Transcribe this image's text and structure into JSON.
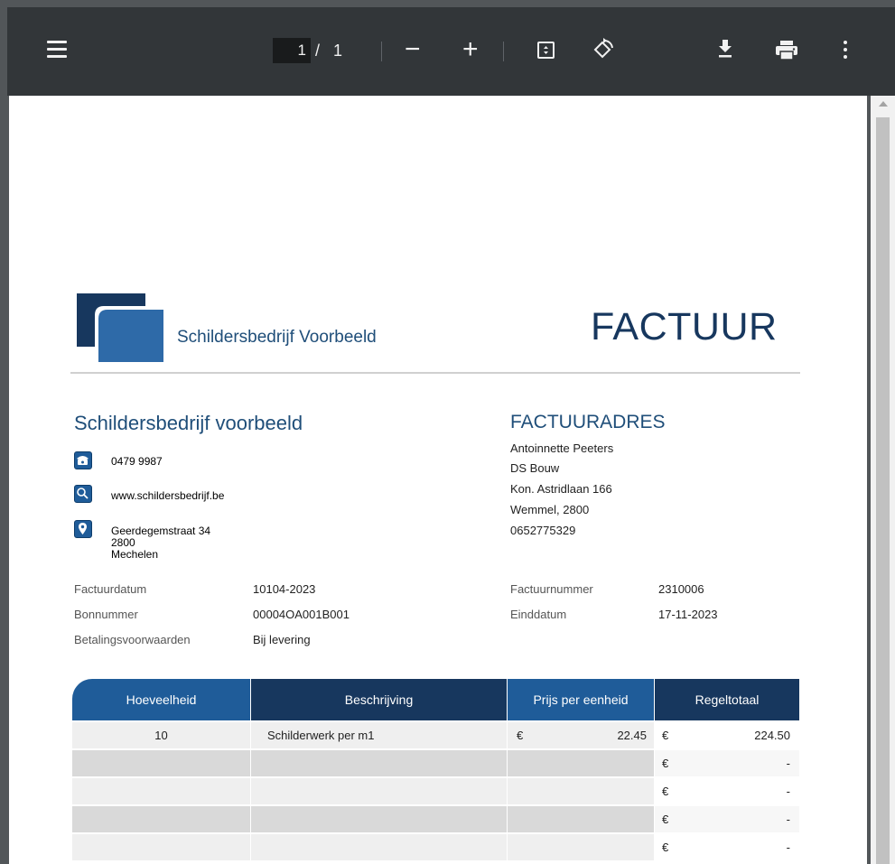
{
  "toolbar": {
    "current_page": "1",
    "page_separator": "/",
    "total_pages": "1",
    "zoom_out": "−",
    "zoom_in": "+",
    "icons": [
      "menu-icon",
      "fit-page-icon",
      "rotate-icon",
      "download-icon",
      "print-icon",
      "more-icon"
    ],
    "bg_color": "#323639"
  },
  "invoice": {
    "header_company": "Schildersbedrijf Voorbeeld",
    "title": "FACTUUR",
    "sender": {
      "name": "Schildersbedrijf voorbeeld",
      "phone": "0479 9987",
      "website": "www.schildersbedrijf.be",
      "street": "Geerdegemstraat 34",
      "postcode": "2800",
      "city": "Mechelen"
    },
    "billto": {
      "title": "FACTUURADRES",
      "lines": [
        "Antoinnette Peeters",
        "DS Bouw",
        "Kon. Astridlaan 166",
        "Wemmel, 2800",
        "0652775329"
      ]
    },
    "meta_left": [
      {
        "label": "Factuurdatum",
        "value": "10104-2023"
      },
      {
        "label": "Bonnummer",
        "value": "00004OA001B001"
      },
      {
        "label": "Betalingsvoorwaarden",
        "value": "Bij levering"
      }
    ],
    "meta_right": [
      {
        "label": "Factuurnummer",
        "value": "2310006"
      },
      {
        "label": "Einddatum",
        "value": "17-11-2023"
      }
    ],
    "table": {
      "headers": [
        "Hoeveelheid",
        "Beschrijving",
        "Prijs per eenheid",
        "Regeltotaal"
      ],
      "rows": [
        {
          "qty": "10",
          "desc": "Schilderwerk per m1",
          "price_cur": "€",
          "price": "22.45",
          "total_cur": "€",
          "total": "224.50"
        },
        {
          "qty": "",
          "desc": "",
          "price_cur": "",
          "price": "",
          "total_cur": "€",
          "total": "-"
        },
        {
          "qty": "",
          "desc": "",
          "price_cur": "",
          "price": "",
          "total_cur": "€",
          "total": "-"
        },
        {
          "qty": "",
          "desc": "",
          "price_cur": "",
          "price": "",
          "total_cur": "€",
          "total": "-"
        },
        {
          "qty": "",
          "desc": "",
          "price_cur": "",
          "price": "",
          "total_cur": "€",
          "total": "-"
        }
      ]
    },
    "colors": {
      "brand_dark": "#17375e",
      "brand_mid": "#1f5c99",
      "header_blue": "#1f5c99",
      "header_navy": "#17375e"
    }
  }
}
